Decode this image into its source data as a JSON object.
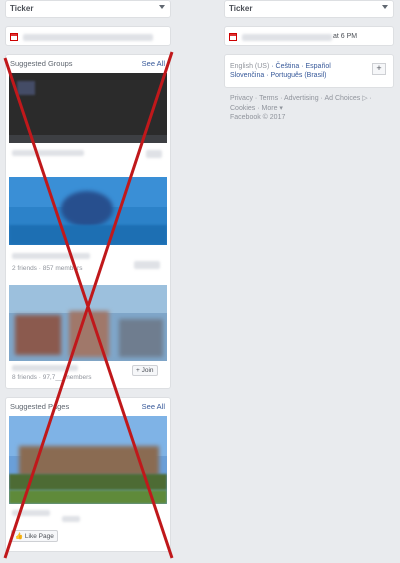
{
  "left": {
    "ticker_label": "Ticker",
    "suggested_groups": {
      "title": "Suggested Groups",
      "see_all": "See All",
      "groups": [
        {
          "meta": ""
        },
        {
          "meta": "2 friends · 857 members"
        },
        {
          "meta": "8 friends · 97,7__ members",
          "button": "+ Join"
        }
      ]
    },
    "suggested_pages": {
      "title": "Suggested Pages",
      "see_all": "See All",
      "like_button": "Like Page"
    }
  },
  "right": {
    "ticker_label": "Ticker",
    "birthday_time": "at 6 PM",
    "languages": {
      "current": "English (US)",
      "others": [
        "Čeština",
        "Español",
        "Slovenčina",
        "Português (Brasil)"
      ]
    },
    "footer": {
      "links": [
        "Privacy",
        "Terms",
        "Advertising",
        "Ad Choices",
        "Cookies",
        "More"
      ],
      "copyright": "Facebook © 2017"
    }
  },
  "colors": {
    "cross": "#c0181b",
    "link": "#365899"
  }
}
